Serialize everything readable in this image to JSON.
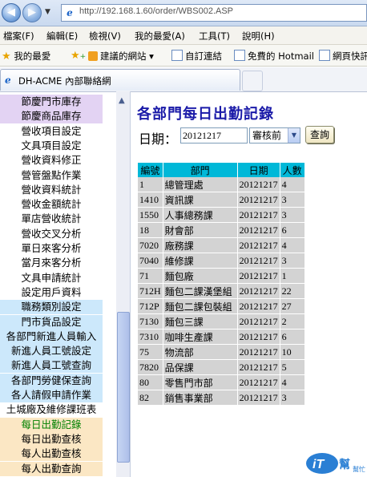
{
  "browser": {
    "url": "http://192.168.1.60/order/WBS002.ASP",
    "menus": [
      "檔案(F)",
      "編輯(E)",
      "檢視(V)",
      "我的最愛(A)",
      "工具(T)",
      "說明(H)"
    ],
    "favorites_label": "我的最愛",
    "favorites": [
      "建議的網站 ▾",
      "自訂連結",
      "免費的 Hotmail",
      "網頁快訊"
    ],
    "tab_title": "DH-ACME 內部聯絡網"
  },
  "sidebar": {
    "items": [
      {
        "label": "節慶門市庫存",
        "bg": "#e3d3f3"
      },
      {
        "label": "節慶商品庫存",
        "bg": "#e3d3f3"
      },
      {
        "label": "營收項目設定",
        "bg": "#ffffff"
      },
      {
        "label": "文具項目設定",
        "bg": "#ffffff"
      },
      {
        "label": "營收資料修正",
        "bg": "#ffffff"
      },
      {
        "label": "營管盤點作業",
        "bg": "#ffffff"
      },
      {
        "label": "營收資料統計",
        "bg": "#ffffff"
      },
      {
        "label": "營收金額統計",
        "bg": "#ffffff"
      },
      {
        "label": "單店營收統計",
        "bg": "#ffffff"
      },
      {
        "label": "營收交叉分析",
        "bg": "#ffffff"
      },
      {
        "label": "單日來客分析",
        "bg": "#ffffff"
      },
      {
        "label": "當月來客分析",
        "bg": "#ffffff"
      },
      {
        "label": "文具申請統計",
        "bg": "#ffffff"
      },
      {
        "label": "設定用戶資料",
        "bg": "#ffffff"
      },
      {
        "label": "職務類別設定",
        "bg": "#cce8fb"
      },
      {
        "label": "門市貨品設定",
        "bg": "#cce8fb"
      },
      {
        "label": "各部門新進人員輸入",
        "bg": "#cce8fb"
      },
      {
        "label": "新進人員工號設定",
        "bg": "#cce8fb"
      },
      {
        "label": "新進人員工號查詢",
        "bg": "#cce8fb"
      },
      {
        "label": "各部門勞健保查詢",
        "bg": "#cce8fb"
      },
      {
        "label": "各人請假申請作業",
        "bg": "#cce8fb"
      },
      {
        "label": "土城廠及維修課班表",
        "bg": "#ffffff"
      },
      {
        "label": "每日出勤記錄",
        "bg": "#fbe7c4",
        "active": true
      },
      {
        "label": "每日出勤查核",
        "bg": "#fbe7c4"
      },
      {
        "label": "每人出勤查核",
        "bg": "#fbe7c4"
      },
      {
        "label": "每人出勤查詢",
        "bg": "#fbe7c4"
      }
    ]
  },
  "main": {
    "title": "各部門每日出勤記錄",
    "date_label": "日期：",
    "date_value": "20121217",
    "status_select": "審核前",
    "query_button": "查詢",
    "table_headers": [
      "編號",
      "部門",
      "日期",
      "人數"
    ],
    "rows": [
      [
        "1",
        "總管理處",
        "20121217",
        "4"
      ],
      [
        "1410",
        "資訊課",
        "20121217",
        "3"
      ],
      [
        "1550",
        "人事總務課",
        "20121217",
        "3"
      ],
      [
        "18",
        "財會部",
        "20121217",
        "6"
      ],
      [
        "7020",
        "廠務課",
        "20121217",
        "4"
      ],
      [
        "7040",
        "維修課",
        "20121217",
        "3"
      ],
      [
        "71",
        "麵包廠",
        "20121217",
        "1"
      ],
      [
        "712H",
        "麵包二課漢堡組",
        "20121217",
        "22"
      ],
      [
        "712P",
        "麵包二課包裝組",
        "20121217",
        "27"
      ],
      [
        "7130",
        "麵包三課",
        "20121217",
        "2"
      ],
      [
        "7310",
        "咖啡生產課",
        "20121217",
        "6"
      ],
      [
        "75",
        "物流部",
        "20121217",
        "10"
      ],
      [
        "7820",
        "品保課",
        "20121217",
        "5"
      ],
      [
        "80",
        "零售門市部",
        "20121217",
        "4"
      ],
      [
        "82",
        "銷售事業部",
        "20121217",
        "3"
      ]
    ]
  },
  "watermark": {
    "text_top": "iT",
    "text_side": "幫",
    "text_small": "幫忙"
  }
}
